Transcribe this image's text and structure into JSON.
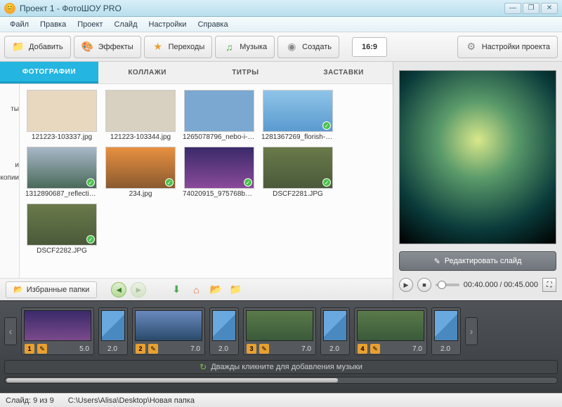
{
  "window": {
    "title": "Проект 1 - ФотоШОУ PRO"
  },
  "menu": {
    "file": "Файл",
    "edit": "Правка",
    "project": "Проект",
    "slide": "Слайд",
    "settings": "Настройки",
    "help": "Справка"
  },
  "toolbar": {
    "add": "Добавить",
    "effects": "Эффекты",
    "transitions": "Переходы",
    "music": "Музыка",
    "create": "Создать",
    "ratio": "16:9",
    "project_settings": "Настройки проекта"
  },
  "tabs": {
    "photos": "ФОТОГРАФИИ",
    "collages": "КОЛЛАЖИ",
    "titles": "ТИТРЫ",
    "splash": "ЗАСТАВКИ"
  },
  "tree_fragments": {
    "a": "ты",
    "b": "и",
    "c": "ервной копии"
  },
  "thumbs": [
    {
      "cap": "121223-103337.jpg",
      "checked": false,
      "bg": "#e8d8c0"
    },
    {
      "cap": "121223-103344.jpg",
      "checked": false,
      "bg": "#d8d0c0"
    },
    {
      "cap": "1265078796_nebo-i-palma...",
      "checked": false,
      "bg": "#7aa8d0"
    },
    {
      "cap": "1281367269_florish-22.jpg",
      "checked": true,
      "bg": "linear-gradient(#8fc4e8,#5a9acf)"
    },
    {
      "cap": "1312890687_reflection...",
      "checked": true,
      "bg": "linear-gradient(#a8b8c8,#4a6a5a)"
    },
    {
      "cap": "234.jpg",
      "checked": true,
      "bg": "linear-gradient(#e89040,#8a5a30)"
    },
    {
      "cap": "74020915_975768ba1...",
      "checked": true,
      "bg": "linear-gradient(#3a2a6a,#8a4a9a)"
    },
    {
      "cap": "DSCF2281.JPG",
      "checked": true,
      "bg": "linear-gradient(#6a7a4a,#4a5a3a)"
    },
    {
      "cap": "DSCF2282.JPG",
      "checked": true,
      "bg": "linear-gradient(#6a7a4a,#4a5a3a)"
    }
  ],
  "browser_bar": {
    "favorites": "Избранные папки"
  },
  "preview": {
    "edit_slide": "Редактировать слайд",
    "time_current": "00:40.000",
    "time_total": "00:45.000"
  },
  "timeline": {
    "slides": [
      {
        "num": "1",
        "dur": "5.0",
        "trans": "2.0",
        "bg": "linear-gradient(#3a2a6a,#7a4a8a)"
      },
      {
        "num": "2",
        "dur": "7.0",
        "trans": "2.0",
        "bg": "linear-gradient(#6a8ac0,#2a4a6a)"
      },
      {
        "num": "3",
        "dur": "7.0",
        "trans": "2.0",
        "bg": "linear-gradient(#5a7a4a,#3a5a3a)"
      },
      {
        "num": "4",
        "dur": "7.0",
        "trans": "2.0",
        "bg": "linear-gradient(#5a7a4a,#3a5a3a)"
      }
    ],
    "music_hint": "Дважды кликните для добавления музыки"
  },
  "status": {
    "slide_of": "Слайд: 9 из 9",
    "path": "C:\\Users\\Alisa\\Desktop\\Новая папка"
  }
}
